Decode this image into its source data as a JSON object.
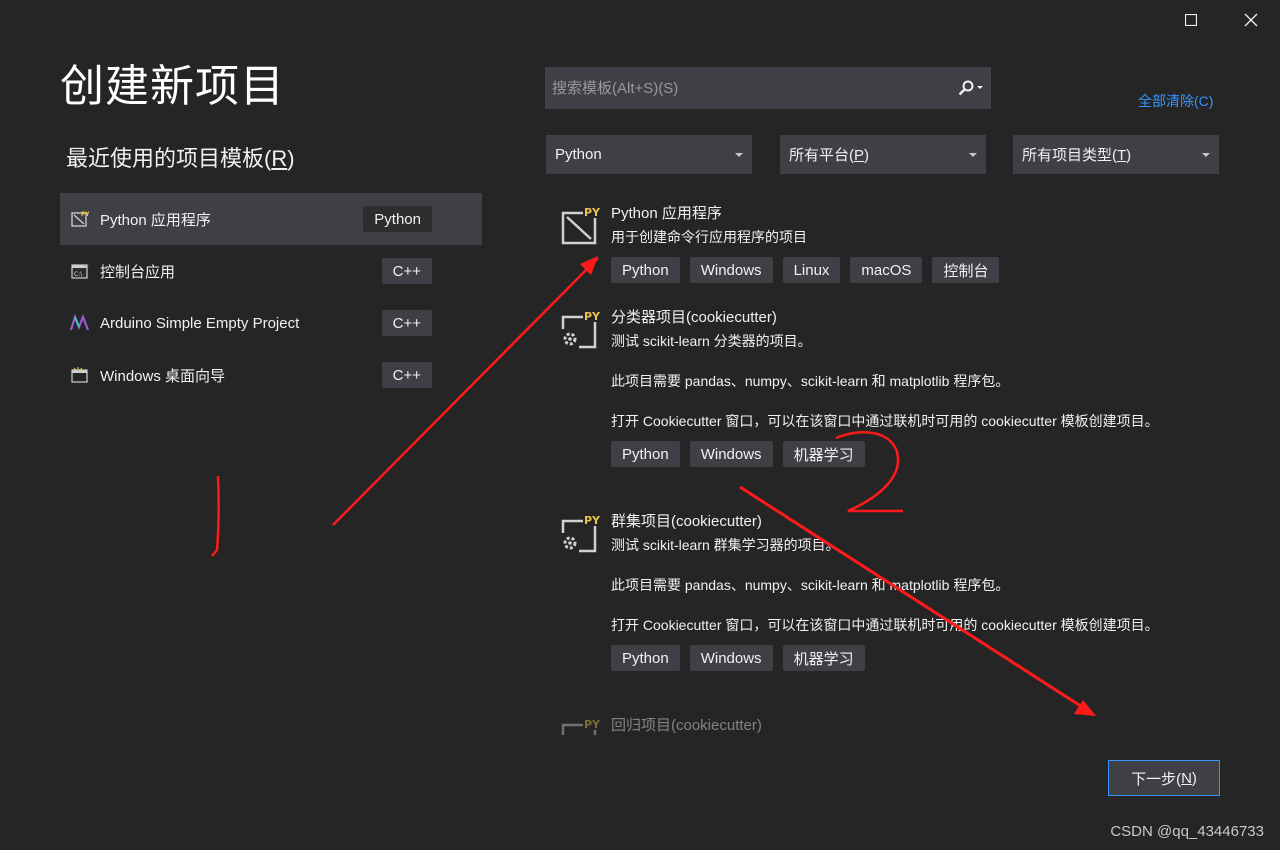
{
  "window": {
    "title": "创建新项目"
  },
  "recent": {
    "heading_pre": "最近使用的项目模板(",
    "heading_key": "R",
    "heading_post": ")",
    "items": [
      {
        "label": "Python 应用程序",
        "badge": "Python",
        "icon": "python-app-icon",
        "selected": true
      },
      {
        "label": "控制台应用",
        "badge": "C++",
        "icon": "console-app-icon"
      },
      {
        "label": "Arduino Simple Empty Project",
        "badge": "C++",
        "icon": "arduino-icon"
      },
      {
        "label": "Windows 桌面向导",
        "badge": "C++",
        "icon": "windows-desktop-icon"
      }
    ]
  },
  "search": {
    "placeholder": "搜索模板(Alt+S)(S)"
  },
  "clear_all": "全部清除(C)",
  "filters": {
    "language": "Python",
    "platform_pre": "所有平台(",
    "platform_key": "P",
    "platform_post": ")",
    "type_pre": "所有项目类型(",
    "type_key": "T",
    "type_post": ")"
  },
  "templates": [
    {
      "title": "Python 应用程序",
      "desc": "用于创建命令行应用程序的项目",
      "tags": [
        "Python",
        "Windows",
        "Linux",
        "macOS",
        "控制台"
      ]
    },
    {
      "title": "分类器项目(cookiecutter)",
      "desc": "测试 scikit-learn 分类器的项目。\n\n此项目需要 pandas、numpy、scikit-learn 和 matplotlib 程序包。\n\n打开 Cookiecutter 窗口，可以在该窗口中通过联机时可用的 cookiecutter 模板创建项目。",
      "tags": [
        "Python",
        "Windows",
        "机器学习"
      ]
    },
    {
      "title": "群集项目(cookiecutter)",
      "desc": "测试 scikit-learn 群集学习器的项目。\n\n此项目需要 pandas、numpy、scikit-learn 和 matplotlib 程序包。\n\n打开 Cookiecutter 窗口，可以在该窗口中通过联机时可用的 cookiecutter 模板创建项目。",
      "tags": [
        "Python",
        "Windows",
        "机器学习"
      ]
    },
    {
      "title": "回归项目(cookiecutter)",
      "desc": "",
      "tags": []
    }
  ],
  "next_button": {
    "pre": "下一步(",
    "key": "N",
    "post": ")"
  },
  "watermark": "CSDN @qq_43446733",
  "colors": {
    "background": "#252526",
    "panel": "#3f3f46",
    "accent": "#3794ff",
    "annotation": "#ff0000"
  }
}
